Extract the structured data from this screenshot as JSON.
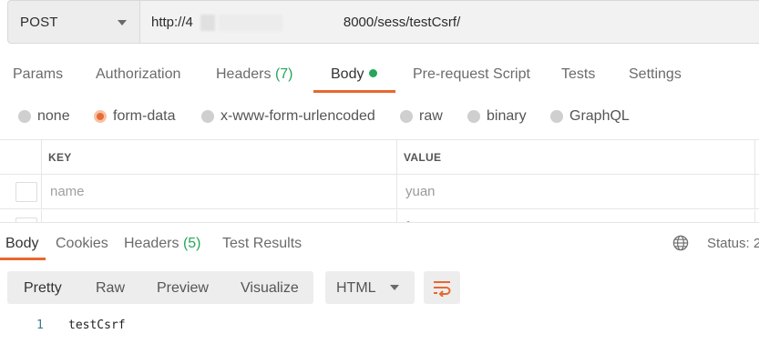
{
  "request": {
    "method": "POST",
    "url": "http://4           8000/sess/testCsrf/"
  },
  "request_tabs": [
    {
      "label": "Params"
    },
    {
      "label": "Authorization"
    },
    {
      "label": "Headers",
      "count": "(7)"
    },
    {
      "label": "Body"
    },
    {
      "label": "Pre-request Script"
    },
    {
      "label": "Tests"
    },
    {
      "label": "Settings"
    }
  ],
  "body_types": [
    {
      "label": "none"
    },
    {
      "label": "form-data"
    },
    {
      "label": "x-www-form-urlencoded"
    },
    {
      "label": "raw"
    },
    {
      "label": "binary"
    },
    {
      "label": "GraphQL"
    }
  ],
  "selected_body_type": "form-data",
  "form_table": {
    "headers": {
      "key": "KEY",
      "value": "VALUE"
    },
    "rows": [
      {
        "key": "name",
        "value": "yuan"
      },
      {
        "key": "",
        "value": "f"
      }
    ]
  },
  "response_tabs": [
    {
      "label": "Body"
    },
    {
      "label": "Cookies"
    },
    {
      "label": "Headers",
      "count": "(5)"
    },
    {
      "label": "Test Results"
    }
  ],
  "status": {
    "label": "Status: 2"
  },
  "view_modes": [
    {
      "label": "Pretty"
    },
    {
      "label": "Raw"
    },
    {
      "label": "Preview"
    },
    {
      "label": "Visualize"
    }
  ],
  "format": "HTML",
  "response_body": [
    {
      "line": "1",
      "text": "testCsrf"
    }
  ],
  "colors": {
    "accent": "#e8672f",
    "count_green": "#26a65b"
  },
  "icons": [
    "chevron-down-icon",
    "globe-icon",
    "wrap-lines-icon",
    "radio-icon",
    "checkbox-icon"
  ]
}
